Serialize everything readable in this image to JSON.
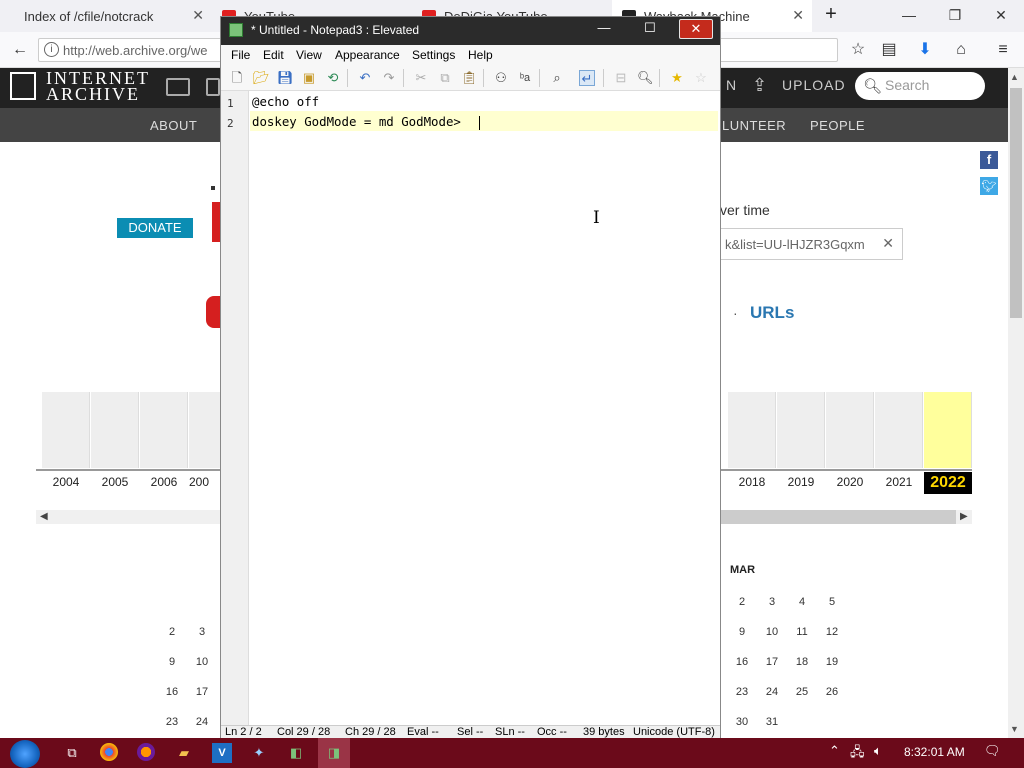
{
  "browser": {
    "tabs": [
      {
        "title": "Index of /cfile/notcrack"
      },
      {
        "title": "YouTube"
      },
      {
        "title": "DeDiGia YouTube"
      },
      {
        "title": "Wayback Machine"
      }
    ],
    "url": "http://web.archive.org/we"
  },
  "archive": {
    "logo_line1": "INTERNET",
    "logo_line2": "ARCHIVE",
    "upload": "UPLOAD",
    "signin_fragment": "N",
    "search_placeholder": "Search",
    "nav": [
      "ABOUT",
      "LUNTEER",
      "PEOPLE"
    ],
    "donate": "DONATE",
    "over_time": "ver time",
    "wb_search_value": "k&list=UU-lHJZR3Gqxm",
    "urls": "URLs",
    "years": [
      "2004",
      "2005",
      "2006",
      "200",
      "2018",
      "2019",
      "2020",
      "2021",
      "2022"
    ],
    "current_year": "2022",
    "month": "MAR",
    "cal_left": [
      [
        "2",
        "3"
      ],
      [
        "9",
        "10"
      ],
      [
        "16",
        "17"
      ],
      [
        "23",
        "24"
      ]
    ],
    "cal_right": [
      [
        "2",
        "3",
        "4",
        "5"
      ],
      [
        "9",
        "10",
        "11",
        "12"
      ],
      [
        "16",
        "17",
        "18",
        "19"
      ],
      [
        "23",
        "24",
        "25",
        "26"
      ],
      [
        "30",
        "31"
      ]
    ]
  },
  "notepad": {
    "title": "* Untitled - Notepad3 : Elevated",
    "menu": [
      "File",
      "Edit",
      "View",
      "Appearance",
      "Settings",
      "Help"
    ],
    "lines": [
      "@echo off",
      "doskey GodMode = md GodMode>"
    ],
    "status": {
      "ln": "Ln 2 / 2",
      "col": "Col 29 / 28",
      "ch": "Ch 29 / 28",
      "eval": "Eval --",
      "sel": "Sel --",
      "sln": "SLn --",
      "occ": "Occ --",
      "bytes": "39 bytes",
      "encoding": "Unicode (UTF-8)"
    }
  },
  "taskbar": {
    "clock": "8:32:01 AM",
    "icons": [
      "task-view-icon",
      "chrome-icon",
      "firefox-icon",
      "folder-icon",
      "vscode-icon",
      "tool-icon",
      "notepad3-icon"
    ]
  },
  "colors": {
    "taskbar": "#6b0a1a",
    "archive_header": "#222222",
    "donate": "#0b8db3",
    "highlight_year": "#ffff9c",
    "current_line": "#ffffd0",
    "urls_link": "#2a77b1"
  }
}
